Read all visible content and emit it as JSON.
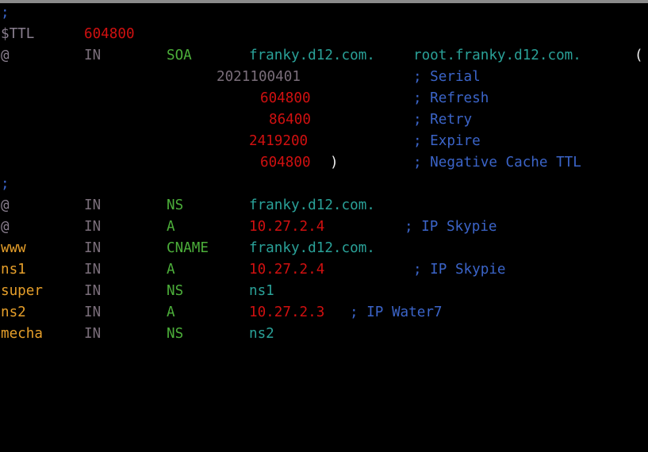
{
  "terminal": {
    "lines": [
      {
        "comment": ";"
      },
      {
        "directive": "$TTL",
        "value": "604800"
      },
      {
        "name": "@",
        "class": "IN",
        "type": "SOA",
        "primary_ns": "franky.d12.com.",
        "admin": "root.franky.d12.com.",
        "paren": "("
      },
      {
        "value": "2021100401",
        "comment": "; Serial"
      },
      {
        "value": "604800",
        "comment": "; Refresh"
      },
      {
        "value": "86400",
        "comment": "; Retry"
      },
      {
        "value": "2419200",
        "comment": "; Expire"
      },
      {
        "value": "604800",
        "paren": ")",
        "comment": "; Negative Cache TTL"
      },
      {
        "comment": ";"
      },
      {
        "name": "@",
        "class": "IN",
        "type": "NS",
        "data": "franky.d12.com."
      },
      {
        "name": "@",
        "class": "IN",
        "type": "A",
        "data": "10.27.2.4",
        "comment": "; IP Skypie"
      },
      {
        "name": "www",
        "class": "IN",
        "type": "CNAME",
        "data": "franky.d12.com."
      },
      {
        "name": "ns1",
        "class": "IN",
        "type": "A",
        "data": "10.27.2.4",
        "comment": "; IP Skypie"
      },
      {
        "name": "super",
        "class": "IN",
        "type": "NS",
        "data": "ns1"
      },
      {
        "name": "ns2",
        "class": "IN",
        "type": "A",
        "data": "10.27.2.3",
        "comment": "; IP Water7"
      },
      {
        "name": "mecha",
        "class": "IN",
        "type": "NS",
        "data": "ns2"
      }
    ]
  }
}
